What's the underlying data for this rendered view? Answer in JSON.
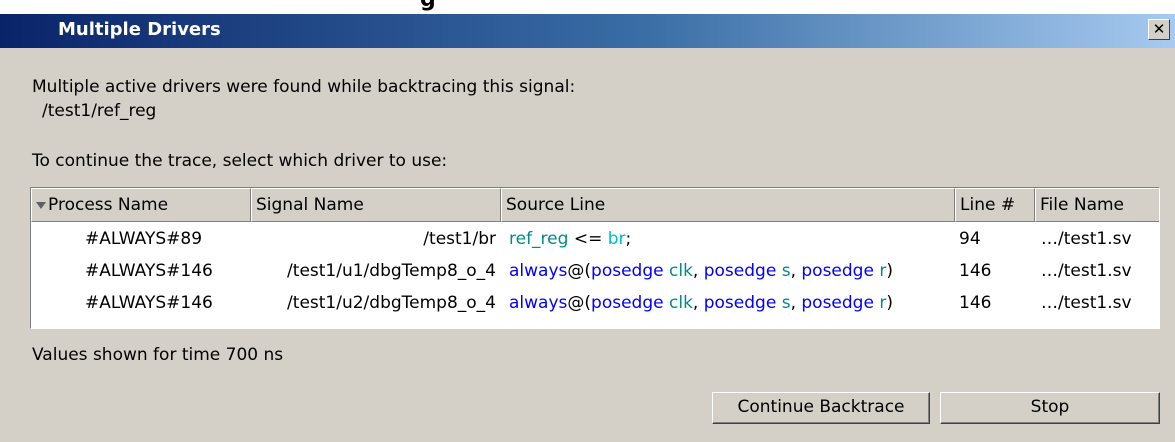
{
  "top_strip_text": "g",
  "dialog": {
    "title": "Multiple Drivers",
    "close_glyph": "✕"
  },
  "message": {
    "line1": "Multiple active drivers were found while backtracing this signal:",
    "signal_path": "/test1/ref_reg",
    "line2": "To continue the trace, select which driver to use:"
  },
  "table": {
    "columns": [
      "Process Name",
      "Signal Name",
      "Source Line",
      "Line #",
      "File Name"
    ],
    "rows": [
      {
        "process": "#ALWAYS#89",
        "signal": "/test1/br",
        "source": [
          {
            "text": "ref_reg",
            "style": "sig"
          },
          {
            "text": " <= ",
            "style": "plain"
          },
          {
            "text": "br",
            "style": "cyan"
          },
          {
            "text": ";",
            "style": "plain"
          }
        ],
        "line": "94",
        "file": "…/test1.sv"
      },
      {
        "process": "#ALWAYS#146",
        "signal": "/test1/u1/dbgTemp8_o_4",
        "source": [
          {
            "text": "always",
            "style": "kw"
          },
          {
            "text": "@(",
            "style": "plain"
          },
          {
            "text": "posedge",
            "style": "kw"
          },
          {
            "text": " ",
            "style": "plain"
          },
          {
            "text": "clk",
            "style": "sig"
          },
          {
            "text": ", ",
            "style": "plain"
          },
          {
            "text": "posedge",
            "style": "kw"
          },
          {
            "text": " ",
            "style": "plain"
          },
          {
            "text": "s",
            "style": "sig"
          },
          {
            "text": ", ",
            "style": "plain"
          },
          {
            "text": "posedge",
            "style": "kw"
          },
          {
            "text": " ",
            "style": "plain"
          },
          {
            "text": "r",
            "style": "sig"
          },
          {
            "text": ")",
            "style": "plain"
          }
        ],
        "line": "146",
        "file": "…/test1.sv"
      },
      {
        "process": "#ALWAYS#146",
        "signal": "/test1/u2/dbgTemp8_o_4",
        "source": [
          {
            "text": "always",
            "style": "kw"
          },
          {
            "text": "@(",
            "style": "plain"
          },
          {
            "text": "posedge",
            "style": "kw"
          },
          {
            "text": " ",
            "style": "plain"
          },
          {
            "text": "clk",
            "style": "sig"
          },
          {
            "text": ", ",
            "style": "plain"
          },
          {
            "text": "posedge",
            "style": "kw"
          },
          {
            "text": " ",
            "style": "plain"
          },
          {
            "text": "s",
            "style": "sig"
          },
          {
            "text": ", ",
            "style": "plain"
          },
          {
            "text": "posedge",
            "style": "kw"
          },
          {
            "text": " ",
            "style": "plain"
          },
          {
            "text": "r",
            "style": "sig"
          },
          {
            "text": ")",
            "style": "plain"
          }
        ],
        "line": "146",
        "file": "…/test1.sv"
      }
    ]
  },
  "footer": {
    "time_text": "Values shown for time  700 ns"
  },
  "buttons": {
    "continue_label": "Continue Backtrace",
    "stop_label": "Stop"
  },
  "colors": {
    "keyword": "#0000ff",
    "signal": "#008b8b",
    "highlight": "#00bcd4",
    "title_gradient_start": "#0a246a",
    "title_gradient_end": "#a6caf0"
  },
  "icons": {
    "sort": "sort-down-icon",
    "close": "close-icon"
  }
}
